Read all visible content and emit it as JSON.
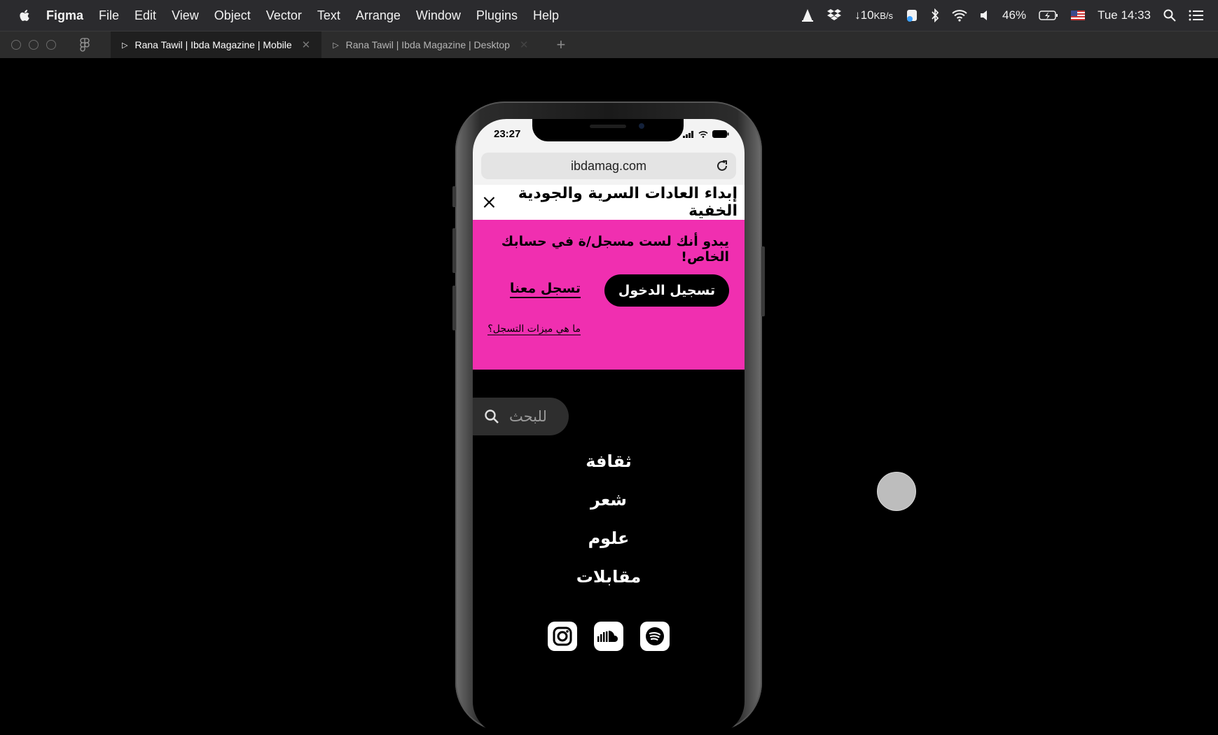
{
  "menubar": {
    "app_name": "Figma",
    "menus": [
      "File",
      "Edit",
      "View",
      "Object",
      "Vector",
      "Text",
      "Arrange",
      "Window",
      "Plugins",
      "Help"
    ],
    "network": "↓10",
    "network_unit": "KB/s",
    "battery": "46%",
    "clock": "Tue 14:33"
  },
  "tabs": [
    {
      "title": "Rana Tawil | Ibda Magazine | Mobile",
      "active": true
    },
    {
      "title": "Rana Tawil | Ibda Magazine | Desktop",
      "active": false
    }
  ],
  "phone": {
    "time": "23:27",
    "url": "ibdamag.com",
    "site_logo": "إبداء العادات السرية والجودية الخفية",
    "promo": {
      "message": "يبدو أنك لست مسجل/ة في حسابك الخاص!",
      "login_label": "تسجيل الدخول",
      "signup_label": "تسجل معنا",
      "features_label": "ما هي ميزات التسجل؟"
    },
    "search_placeholder": "للبحث",
    "nav": [
      "ثقافة",
      "شعر",
      "علوم",
      "مقابلات"
    ],
    "social": [
      "instagram-icon",
      "soundcloud-icon",
      "spotify-icon"
    ]
  },
  "colors": {
    "promo_bg": "#f02fb0",
    "background": "#000000",
    "menubar_bg": "#2b2b2e"
  }
}
